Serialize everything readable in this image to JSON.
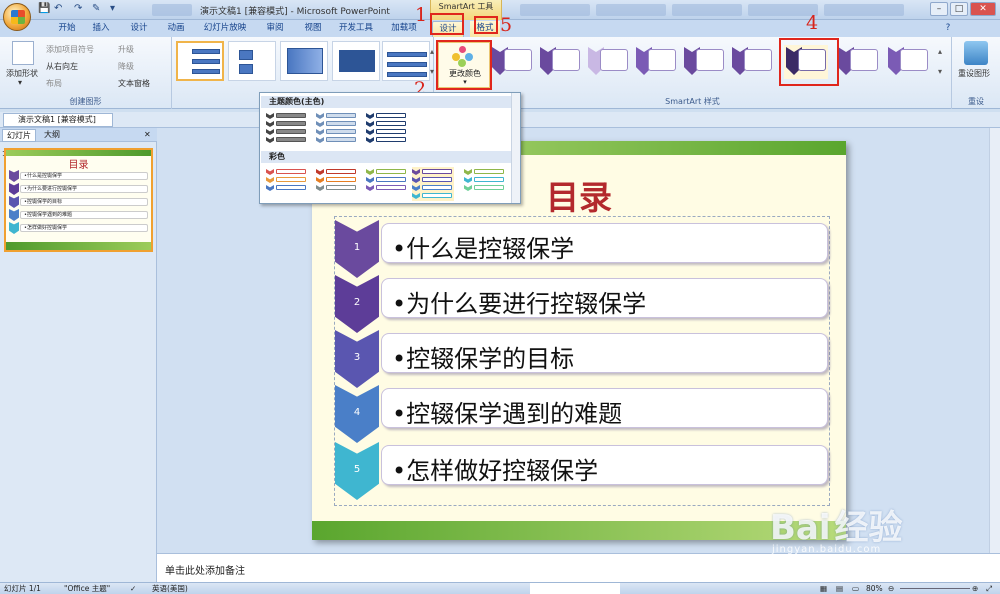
{
  "window": {
    "title": "演示文稿1 [兼容模式] - Microsoft PowerPoint",
    "context_tool_title": "SmartArt 工具"
  },
  "tabs": [
    "开始",
    "插入",
    "设计",
    "动画",
    "幻灯片放映",
    "审阅",
    "视图",
    "开发工具",
    "加载项"
  ],
  "context_tabs": {
    "design": "设计",
    "format": "格式"
  },
  "ribbon": {
    "create_group": {
      "add_shape": "添加形状",
      "add_bullet": "添加项目符号",
      "right_to_left": "从右向左",
      "layout": "布局",
      "promote": "升级",
      "demote": "降级",
      "text_pane": "文本窗格",
      "label": "创建图形"
    },
    "change_colors": "更改颜色",
    "styles_label": "SmartArt 样式",
    "reset_graphic": "重设图形",
    "reset_label": "重设"
  },
  "dropdown": {
    "theme_colors_header": "主题颜色(主色)",
    "colorful_header": "彩色"
  },
  "annotations": [
    "1",
    "2",
    "3",
    "4",
    "5"
  ],
  "document_tab": "演示文稿1 [兼容模式]",
  "panel_tabs": {
    "slides": "幻灯片",
    "outline": "大纲"
  },
  "thumbnail": {
    "number": "1"
  },
  "slide": {
    "title": "目录",
    "items": [
      {
        "num": "1",
        "text": "•什么是控辍保学",
        "color": "#6a4a9e"
      },
      {
        "num": "2",
        "text": "•为什么要进行控辍保学",
        "color": "#5d3d98"
      },
      {
        "num": "3",
        "text": "•控辍保学的目标",
        "color": "#5a56b0"
      },
      {
        "num": "4",
        "text": "•控辍保学遇到的难题",
        "color": "#4a7fc8"
      },
      {
        "num": "5",
        "text": "•怎样做好控辍保学",
        "color": "#3fb6d0"
      }
    ]
  },
  "notes_placeholder": "单击此处添加备注",
  "status": {
    "slide_count": "幻灯片 1/1",
    "theme": "\"Office 主题\"",
    "language": "英语(美国)",
    "zoom": "80%"
  },
  "watermark": {
    "brand": "Bai",
    "brand_cn": "经验",
    "url": "jingyan.baidu.com"
  },
  "colors": {
    "accent_red": "#e0261c",
    "title_red": "#b3292d",
    "selection_orange": "#f0b44a"
  }
}
